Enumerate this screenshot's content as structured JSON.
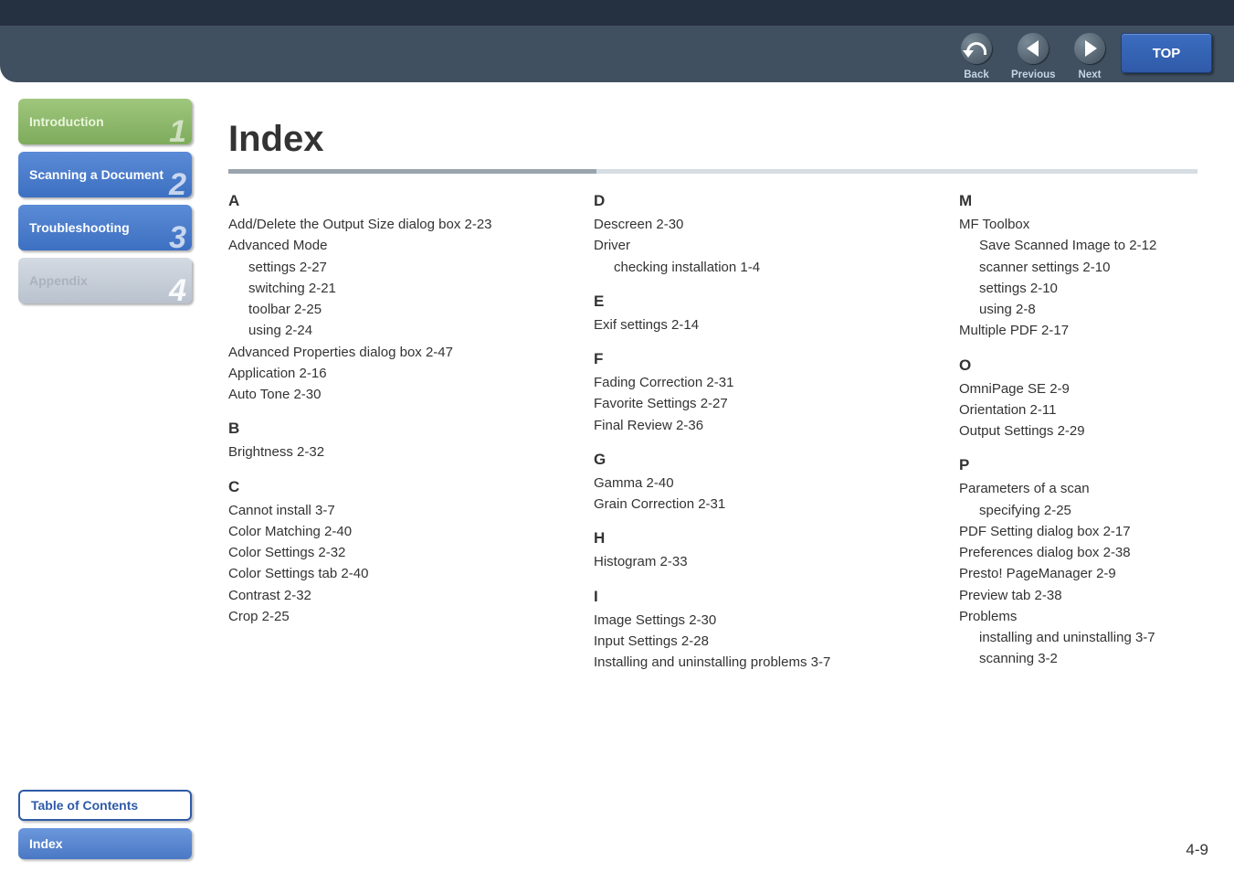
{
  "top_button": "TOP",
  "nav_buttons": {
    "back": "Back",
    "previous": "Previous",
    "next": "Next"
  },
  "side_nav": [
    {
      "label": "Introduction",
      "num": "1",
      "style": "green"
    },
    {
      "label": "Scanning a Document",
      "num": "2",
      "style": "blue"
    },
    {
      "label": "Troubleshooting",
      "num": "3",
      "style": "blue"
    },
    {
      "label": "Appendix",
      "num": "4",
      "style": "grey"
    }
  ],
  "bottom_left": {
    "toc": "Table of Contents",
    "index": "Index"
  },
  "page_title": "Index",
  "page_number": "4-9",
  "index": {
    "col1": [
      {
        "type": "letter",
        "text": "A"
      },
      {
        "type": "entry",
        "text": "Add/Delete the Output Size dialog box 2-23"
      },
      {
        "type": "entry",
        "text": "Advanced Mode"
      },
      {
        "type": "sub",
        "text": "settings 2-27"
      },
      {
        "type": "sub",
        "text": "switching 2-21"
      },
      {
        "type": "sub",
        "text": "toolbar 2-25"
      },
      {
        "type": "sub",
        "text": "using 2-24"
      },
      {
        "type": "entry",
        "text": "Advanced Properties dialog box 2-47"
      },
      {
        "type": "entry",
        "text": "Application 2-16"
      },
      {
        "type": "entry",
        "text": "Auto Tone 2-30"
      },
      {
        "type": "letter",
        "text": "B"
      },
      {
        "type": "entry",
        "text": "Brightness 2-32"
      },
      {
        "type": "letter",
        "text": "C"
      },
      {
        "type": "entry",
        "text": "Cannot install 3-7"
      },
      {
        "type": "entry",
        "text": "Color Matching 2-40"
      },
      {
        "type": "entry",
        "text": "Color Settings 2-32"
      },
      {
        "type": "entry",
        "text": "Color Settings tab 2-40"
      },
      {
        "type": "entry",
        "text": "Contrast 2-32"
      },
      {
        "type": "entry",
        "text": "Crop 2-25"
      }
    ],
    "col2": [
      {
        "type": "letter",
        "text": "D"
      },
      {
        "type": "entry",
        "text": "Descreen 2-30"
      },
      {
        "type": "entry",
        "text": "Driver"
      },
      {
        "type": "sub",
        "text": "checking installation 1-4"
      },
      {
        "type": "letter",
        "text": "E"
      },
      {
        "type": "entry",
        "text": "Exif settings 2-14"
      },
      {
        "type": "letter",
        "text": "F"
      },
      {
        "type": "entry",
        "text": "Fading Correction 2-31"
      },
      {
        "type": "entry",
        "text": "Favorite Settings 2-27"
      },
      {
        "type": "entry",
        "text": "Final Review 2-36"
      },
      {
        "type": "letter",
        "text": "G"
      },
      {
        "type": "entry",
        "text": "Gamma 2-40"
      },
      {
        "type": "entry",
        "text": "Grain Correction 2-31"
      },
      {
        "type": "letter",
        "text": "H"
      },
      {
        "type": "entry",
        "text": "Histogram 2-33"
      },
      {
        "type": "letter",
        "text": "I"
      },
      {
        "type": "entry",
        "text": "Image Settings 2-30"
      },
      {
        "type": "entry",
        "text": "Input Settings 2-28"
      },
      {
        "type": "entry",
        "text": "Installing and uninstalling problems 3-7"
      }
    ],
    "col3": [
      {
        "type": "letter",
        "text": "M"
      },
      {
        "type": "entry",
        "text": "MF Toolbox"
      },
      {
        "type": "sub",
        "text": "Save Scanned Image to 2-12"
      },
      {
        "type": "sub",
        "text": "scanner settings 2-10"
      },
      {
        "type": "sub",
        "text": "settings 2-10"
      },
      {
        "type": "sub",
        "text": "using 2-8"
      },
      {
        "type": "entry",
        "text": "Multiple PDF 2-17"
      },
      {
        "type": "letter",
        "text": "O"
      },
      {
        "type": "entry",
        "text": "OmniPage SE 2-9"
      },
      {
        "type": "entry",
        "text": "Orientation 2-11"
      },
      {
        "type": "entry",
        "text": "Output Settings 2-29"
      },
      {
        "type": "letter",
        "text": "P"
      },
      {
        "type": "entry",
        "text": "Parameters of a scan"
      },
      {
        "type": "sub",
        "text": "specifying 2-25"
      },
      {
        "type": "entry",
        "text": "PDF Setting dialog box 2-17"
      },
      {
        "type": "entry",
        "text": "Preferences dialog box 2-38"
      },
      {
        "type": "entry",
        "text": "Presto! PageManager 2-9"
      },
      {
        "type": "entry",
        "text": "Preview tab 2-38"
      },
      {
        "type": "entry",
        "text": "Problems"
      },
      {
        "type": "sub",
        "text": "installing and uninstalling 3-7"
      },
      {
        "type": "sub",
        "text": "scanning 3-2"
      }
    ]
  }
}
